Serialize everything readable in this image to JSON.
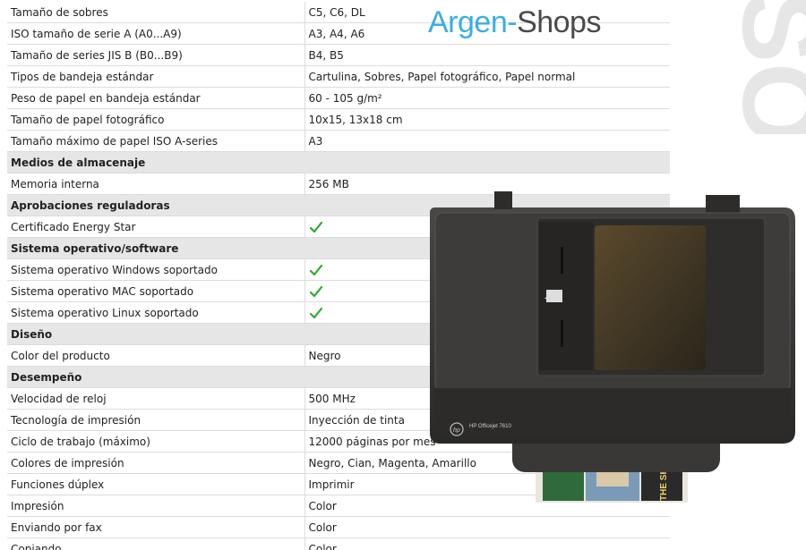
{
  "brand": {
    "part1": "Argen-",
    "part2": "Shops",
    "color1": "#3aaee0",
    "color2": "#4a4a4a"
  },
  "watermark_text": "SO",
  "printer": {
    "label": "HP Officejet 7610",
    "logo": "hp",
    "paper_text": "THE SHORE LINE FASHION"
  },
  "colors": {
    "section_bg": "#e6e6e6",
    "check": "#2ea82e"
  },
  "rows": [
    {
      "type": "row",
      "label": "Tamaño de sobres",
      "value": "C5, C6, DL"
    },
    {
      "type": "row",
      "label": "ISO tamaño de serie A (A0...A9)",
      "value": "A3, A4, A6"
    },
    {
      "type": "row",
      "label": "Tamaño de series JIS B (B0...B9)",
      "value": "B4, B5"
    },
    {
      "type": "row",
      "label": "Tipos de bandeja estándar",
      "value": "Cartulina, Sobres, Papel fotográfico, Papel normal"
    },
    {
      "type": "row",
      "label": "Peso de papel en bandeja estándar",
      "value": "60 - 105 g/m²"
    },
    {
      "type": "row",
      "label": "Tamaño de papel fotográfico",
      "value": "10x15, 13x18 cm"
    },
    {
      "type": "row",
      "label": "Tamaño máximo de papel ISO A-series",
      "value": "A3"
    },
    {
      "type": "section",
      "label": "Medios de almacenaje"
    },
    {
      "type": "row",
      "label": "Memoria interna",
      "value": "256 MB"
    },
    {
      "type": "section",
      "label": "Aprobaciones reguladoras"
    },
    {
      "type": "row",
      "label": "Certificado Energy Star",
      "check": true
    },
    {
      "type": "section",
      "label": "Sistema operativo/software"
    },
    {
      "type": "row",
      "label": "Sistema operativo Windows soportado",
      "check": true
    },
    {
      "type": "row",
      "label": "Sistema operativo MAC soportado",
      "check": true
    },
    {
      "type": "row",
      "label": "Sistema operativo Linux soportado",
      "check": true
    },
    {
      "type": "section",
      "label": "Diseño"
    },
    {
      "type": "row",
      "label": "Color del producto",
      "value": "Negro"
    },
    {
      "type": "section",
      "label": "Desempeño"
    },
    {
      "type": "row",
      "label": "Velocidad de reloj",
      "value": "500 MHz"
    },
    {
      "type": "row",
      "label": "Tecnología de impresión",
      "value": "Inyección de tinta"
    },
    {
      "type": "row",
      "label": "Ciclo de trabajo (máximo)",
      "value": "12000 páginas por mes"
    },
    {
      "type": "row",
      "label": "Colores de impresión",
      "value": "Negro, Cian, Magenta, Amarillo"
    },
    {
      "type": "row",
      "label": "Funciones dúplex",
      "value": "Imprimir"
    },
    {
      "type": "row",
      "label": "Impresión",
      "value": "Color"
    },
    {
      "type": "row",
      "label": "Enviando por fax",
      "value": "Color"
    },
    {
      "type": "row",
      "label": "Copiando",
      "value": "Color"
    }
  ]
}
